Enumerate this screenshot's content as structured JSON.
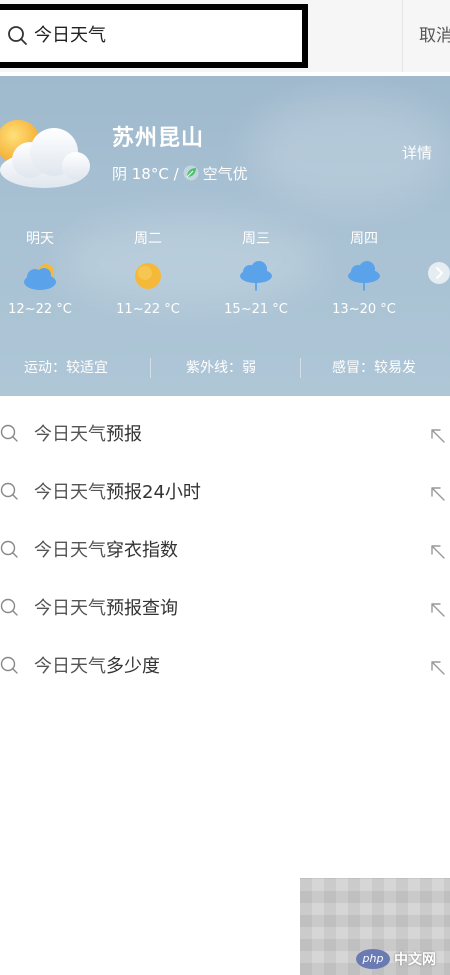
{
  "search": {
    "query": "今日天气",
    "cancel_label": "取消"
  },
  "weather": {
    "city": "苏州昆山",
    "condition": "阴 18°C /",
    "air_quality": "空气优",
    "detail_label": "详情",
    "forecast": [
      {
        "day": "明天",
        "icon": "cloudy-icon",
        "temp": "12~22 °C"
      },
      {
        "day": "周二",
        "icon": "sunny-icon",
        "temp": "11~22 °C"
      },
      {
        "day": "周三",
        "icon": "rain-icon",
        "temp": "15~21 °C"
      },
      {
        "day": "周四",
        "icon": "rain-icon",
        "temp": "13~20 °C"
      }
    ],
    "indices": [
      {
        "label": "运动：较适宜"
      },
      {
        "label": "紫外线：弱"
      },
      {
        "label": "感冒：较易发"
      }
    ]
  },
  "suggestions": [
    {
      "prefix": "今日天气",
      "suffix": "预报"
    },
    {
      "prefix": "今日天气",
      "suffix": "预报24小时"
    },
    {
      "prefix": "今日天气",
      "suffix": "穿衣指数"
    },
    {
      "prefix": "今日天气",
      "suffix": "预报查询"
    },
    {
      "prefix": "今日天气",
      "suffix": "多少度"
    }
  ],
  "watermark": {
    "logo_text": "php",
    "site_text": "中文网"
  },
  "colors": {
    "card_background": "#a8c1d3",
    "air_quality_leaf": "#4cc36a",
    "sun": "#f5b93a",
    "rain_cloud": "#5aa3ea"
  }
}
